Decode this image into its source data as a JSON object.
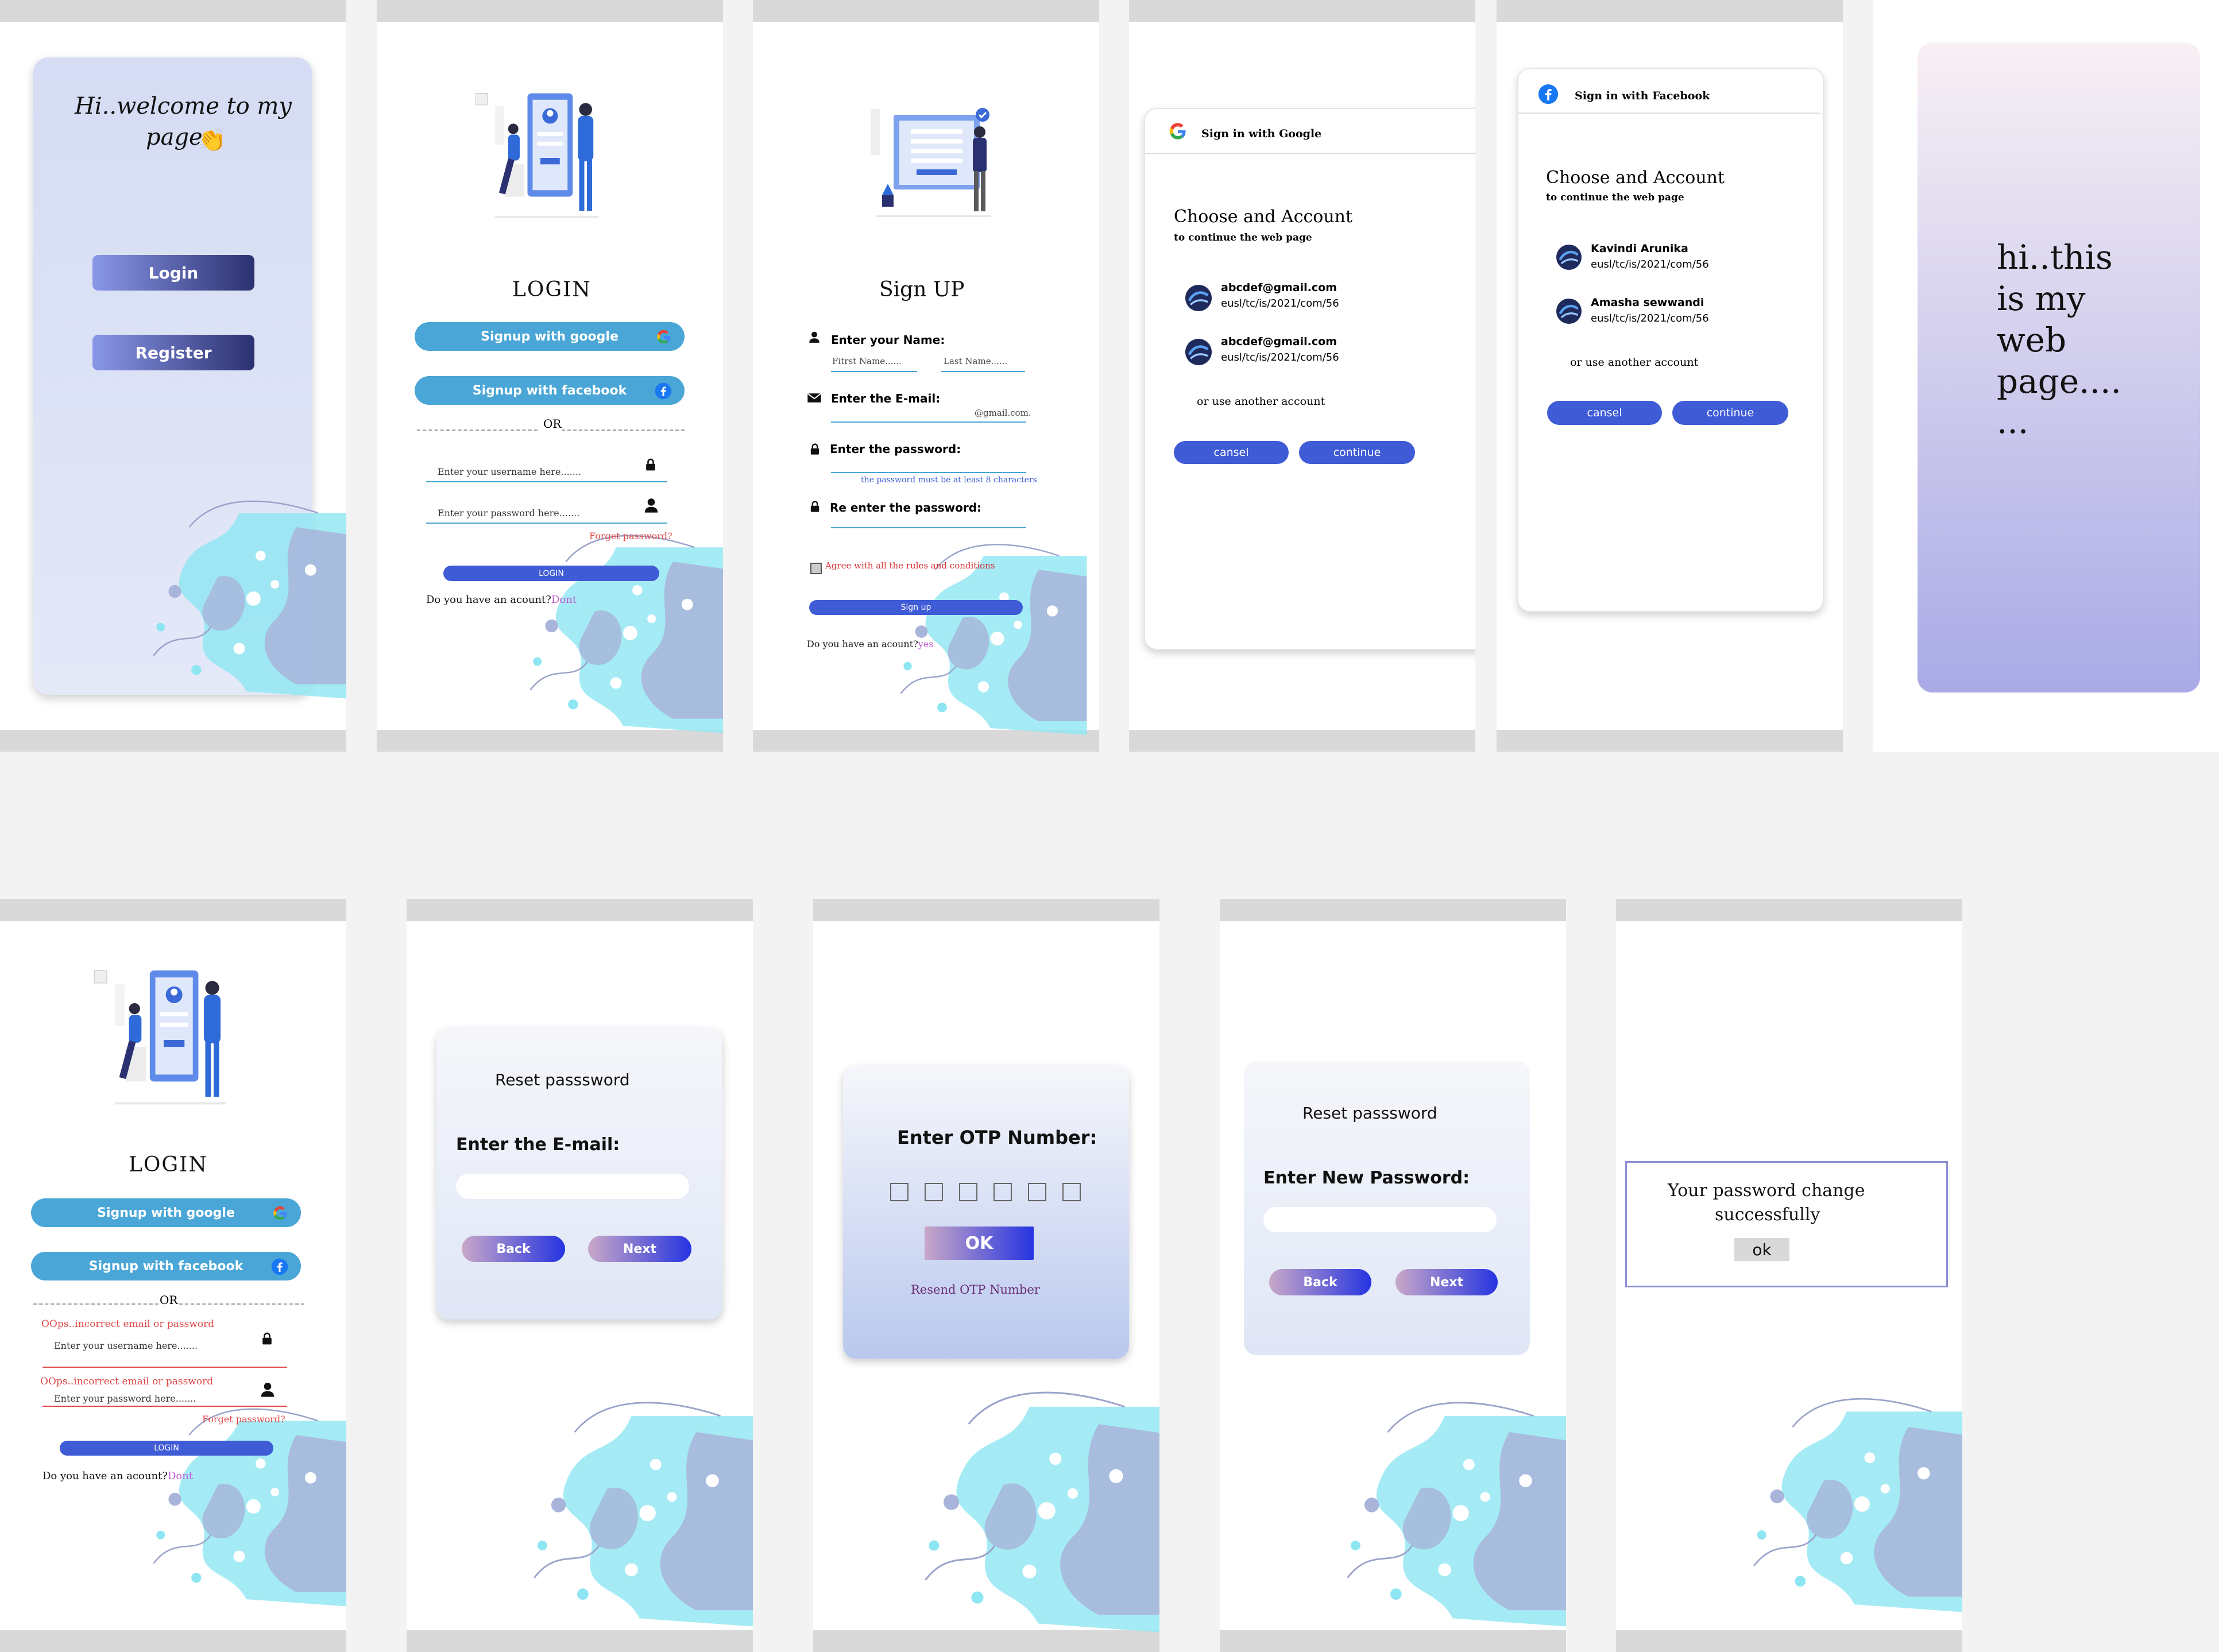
{
  "s1": {
    "title_line1": "Hi..welcome to my",
    "title_line2": "page",
    "emoji": "👏",
    "login": "Login",
    "register": "Register"
  },
  "s2": {
    "title": "LOGIN",
    "google": "Signup with google",
    "facebook": "Signup with facebook",
    "or": "OR",
    "username_ph": "Enter your username  here.......",
    "password_ph": "Enter your password  here.......",
    "forget": "Forget password?",
    "login": "LOGIN",
    "account_q": "Do you have an acount?",
    "dont": "Dont"
  },
  "s3": {
    "title": "Sign UP",
    "name_label": "Enter your Name:",
    "first": "Fitrst Name......",
    "last": "Last Name......",
    "email_label": "Enter the E-mail:",
    "email_hint": "@gmail.com.",
    "pw_label": "Enter the password:",
    "pw_hint": "the password must be at least 8 characters",
    "re_label": "Re enter the password:",
    "agree": "Agree with all the rules and conditions",
    "signup": "Sign up",
    "account_q": "Do you have an acount?",
    "yes": "yes"
  },
  "s4": {
    "header": "Sign in with Google",
    "title": "Choose and Account",
    "subtitle": "to continue the web page",
    "accounts": [
      {
        "name": "abcdef@gmail.com",
        "id": "eusl/tc/is/2021/com/56"
      },
      {
        "name": "abcdef@gmail.com",
        "id": "eusl/tc/is/2021/com/56"
      }
    ],
    "another": "or use another account",
    "cancel": "cansel",
    "continue": "continue"
  },
  "s5": {
    "header": "Sign in with Facebook",
    "title": "Choose and Account",
    "subtitle": "to continue the web page",
    "accounts": [
      {
        "name": "Kavindi Arunika",
        "id": "eusl/tc/is/2021/com/56"
      },
      {
        "name": "Amasha sewwandi",
        "id": "eusl/tc/is/2021/com/56"
      }
    ],
    "another": "or use another account",
    "cancel": "cansel",
    "continue": "continue"
  },
  "s6": {
    "line1": "hi..this",
    "line2": "is my",
    "line3": "web",
    "line4": "page....",
    "line5": "..."
  },
  "s7": {
    "title": "LOGIN",
    "google": "Signup with google",
    "facebook": "Signup with facebook",
    "or": "OR",
    "err1": "OOps..incorrect email or password",
    "username_ph": "Enter your username  here.......",
    "err2": "OOps..incorrect email or password",
    "password_ph": "Enter your password  here.......",
    "forget": "Forget password?",
    "login": "LOGIN",
    "account_q": "Do you have an acount?",
    "dont": "Dont"
  },
  "s8": {
    "title": "Reset passsword",
    "label": "Enter the E-mail:",
    "back": "Back",
    "next": "Next"
  },
  "s9": {
    "title": "Enter  OTP Number:",
    "ok": "OK",
    "resend": "Resend  OTP  Number"
  },
  "s10": {
    "title": "Reset passsword",
    "label": "Enter New Password:",
    "back": "Back",
    "next": "Next"
  },
  "s11": {
    "message_line1": "Your password  change",
    "message_line2": "successfully",
    "ok": "ok"
  },
  "colors": {
    "primary": "#3f5bd6",
    "sky": "#4aa6d6",
    "navy": "#2b3170",
    "lavender": "#c9c6ee",
    "red": "#e04848",
    "gray": "#d9d9d9"
  }
}
